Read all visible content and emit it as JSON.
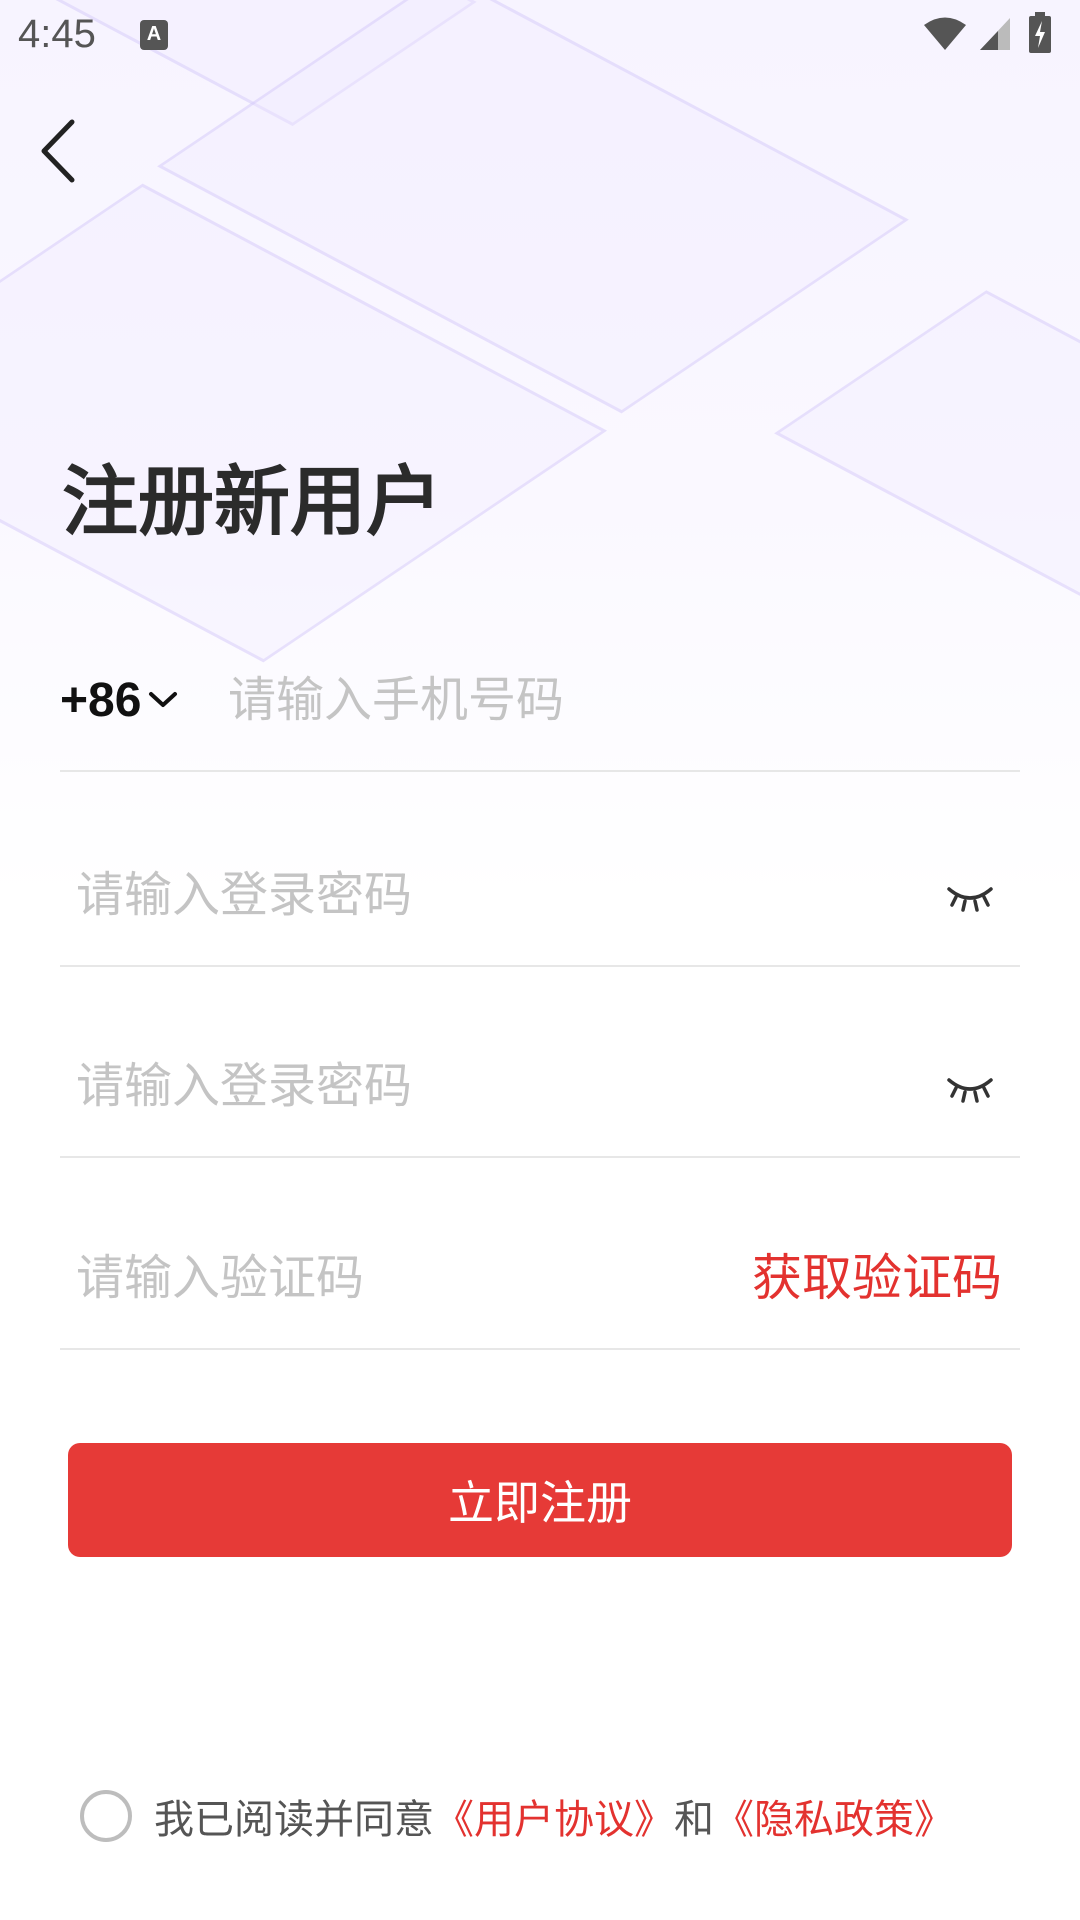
{
  "status_bar": {
    "time": "4:45",
    "a_icon_label": "A"
  },
  "page": {
    "title": "注册新用户"
  },
  "phone": {
    "country_code": "+86",
    "placeholder": "请输入手机号码"
  },
  "password": {
    "placeholder": "请输入登录密码"
  },
  "confirm_password": {
    "placeholder": "请输入登录密码"
  },
  "verification": {
    "placeholder": "请输入验证码",
    "get_code_label": "获取验证码"
  },
  "register_button": {
    "label": "立即注册"
  },
  "agreement": {
    "prefix": "我已阅读并同意",
    "user_agreement": "《用户协议》",
    "conjunction": "和",
    "privacy_policy": "《隐私政策》"
  },
  "colors": {
    "accent": "#e63a37",
    "link": "#e3322f",
    "title": "#2b2b2b",
    "placeholder": "#c4c4c4"
  },
  "icons": {
    "back": "back-arrow-icon",
    "dropdown": "chevron-down-icon",
    "password_toggle": "eye-closed-icon",
    "wifi": "wifi-icon",
    "signal": "signal-icon",
    "battery": "battery-icon"
  }
}
